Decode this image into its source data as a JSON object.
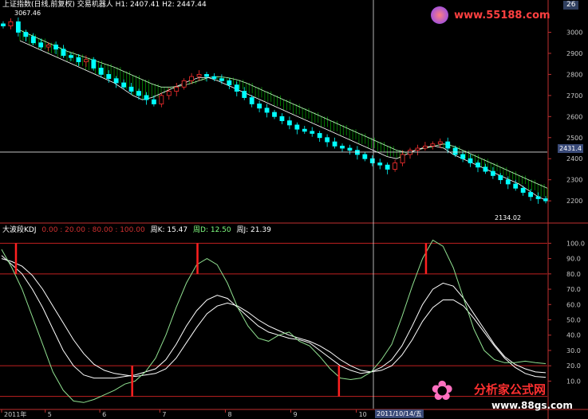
{
  "header": {
    "index_label": "上证指数(日线,前复权)",
    "indicator_name": "交易机器人",
    "h1": "H1: 2407.41",
    "h2": "H2: 2447.44",
    "high_marker": "3067.46",
    "corner_value": "26"
  },
  "kdj_header": {
    "name": "大波段KDJ",
    "levels": "0.00 : 20.00 : 80.00 : 100.00",
    "k": "周K: 15.47",
    "d": "周D: 12.50",
    "j": "周J: 21.39"
  },
  "crosshair": {
    "price": "2431.4",
    "date": "2011/10/14/五"
  },
  "low_marker": "2134.02",
  "watermarks": {
    "top_url": "www.55188.com",
    "bottom_title": "分析家公式网",
    "bottom_url": "www.88gs.com"
  },
  "colors": {
    "background": "#000000",
    "up_candle": "#ff3030",
    "down_candle": "#00ffff",
    "band_fill": "#00c800",
    "k_line": "#ffffff",
    "d_line": "#ffffff",
    "j_line": "#90e090",
    "level_line": "#c02020",
    "signal_bar": "#ff2020"
  },
  "chart_data": [
    {
      "type": "candlestick",
      "title": "上证指数(日线,前复权)",
      "y_ticks": [
        3000,
        2900,
        2800,
        2700,
        2600,
        2500,
        2400,
        2300,
        2200
      ],
      "ylim": [
        2140,
        3070
      ],
      "x_ticks": [
        "2011年",
        "5",
        "6",
        "7",
        "8",
        "9",
        "10"
      ],
      "close_series": [
        3030,
        3050,
        3000,
        2980,
        2950,
        2930,
        2940,
        2920,
        2890,
        2880,
        2860,
        2870,
        2830,
        2800,
        2780,
        2760,
        2740,
        2720,
        2700,
        2680,
        2660,
        2700,
        2720,
        2740,
        2770,
        2790,
        2800,
        2790,
        2780,
        2770,
        2750,
        2720,
        2690,
        2660,
        2640,
        2620,
        2600,
        2580,
        2560,
        2540,
        2530,
        2520,
        2500,
        2480,
        2460,
        2450,
        2440,
        2420,
        2400,
        2380,
        2370,
        2350,
        2380,
        2420,
        2440,
        2450,
        2460,
        2470,
        2480,
        2450,
        2420,
        2400,
        2380,
        2360,
        2340,
        2320,
        2300,
        2280,
        2260,
        2240,
        2220,
        2210,
        2200
      ],
      "band_top": [
        3010,
        2990,
        2970,
        2950,
        2930,
        2910,
        2895,
        2880,
        2865,
        2850,
        2835,
        2815,
        2795,
        2775,
        2755,
        2740,
        2740,
        2745,
        2755,
        2770,
        2785,
        2790,
        2785,
        2775,
        2760,
        2740,
        2720,
        2700,
        2680,
        2660,
        2640,
        2620,
        2600,
        2580,
        2560,
        2540,
        2520,
        2500,
        2480,
        2460,
        2440,
        2430,
        2440,
        2450,
        2460,
        2470,
        2460,
        2440,
        2420,
        2400,
        2380,
        2360,
        2340,
        2320,
        2300,
        2280,
        2260
      ],
      "band_bottom": [
        2960,
        2940,
        2920,
        2900,
        2880,
        2860,
        2840,
        2820,
        2800,
        2780,
        2760,
        2730,
        2700,
        2680,
        2690,
        2710,
        2730,
        2750,
        2770,
        2785,
        2785,
        2770,
        2750,
        2730,
        2710,
        2690,
        2670,
        2650,
        2630,
        2610,
        2590,
        2570,
        2550,
        2530,
        2510,
        2490,
        2470,
        2450,
        2430,
        2410,
        2400,
        2420,
        2440,
        2455,
        2460,
        2450,
        2420,
        2400,
        2380,
        2360,
        2340,
        2320,
        2300,
        2280,
        2250,
        2220,
        2200
      ]
    },
    {
      "type": "line",
      "title": "大波段KDJ",
      "y_ticks": [
        100.0,
        90.0,
        80.0,
        70.0,
        60.0,
        50.0,
        40.0,
        30.0,
        20.0,
        10.0
      ],
      "ylim": [
        -8,
        108
      ],
      "levels": [
        0,
        20,
        80,
        100
      ],
      "series": [
        {
          "name": "周K",
          "values": [
            92,
            86,
            80,
            70,
            58,
            44,
            30,
            20,
            14,
            12,
            12,
            12,
            13,
            14,
            16,
            18,
            24,
            34,
            46,
            56,
            63,
            66,
            64,
            58,
            52,
            46,
            42,
            40,
            38,
            37,
            35,
            30,
            25,
            20,
            17,
            15,
            16,
            19,
            24,
            33,
            46,
            60,
            70,
            74,
            72,
            64,
            54,
            44,
            34,
            26,
            21,
            18,
            16,
            15.47
          ]
        },
        {
          "name": "周D",
          "values": [
            90,
            88,
            85,
            79,
            70,
            59,
            48,
            37,
            28,
            21,
            17,
            15,
            14,
            13,
            14,
            15,
            18,
            25,
            35,
            45,
            54,
            59,
            61,
            59,
            55,
            50,
            46,
            43,
            40,
            38,
            36,
            33,
            29,
            24,
            20,
            17,
            16,
            17,
            20,
            27,
            37,
            49,
            58,
            63,
            63,
            59,
            51,
            42,
            33,
            25,
            19,
            15,
            13,
            12.5
          ]
        },
        {
          "name": "周J",
          "values": [
            96,
            84,
            70,
            52,
            34,
            16,
            4,
            -3,
            -4,
            -2,
            1,
            4,
            8,
            10,
            16,
            25,
            40,
            58,
            74,
            86,
            90,
            86,
            74,
            58,
            46,
            38,
            36,
            40,
            42,
            36,
            33,
            26,
            18,
            12,
            11,
            12,
            16,
            24,
            34,
            52,
            72,
            90,
            102,
            98,
            84,
            64,
            44,
            30,
            24,
            22,
            22,
            23,
            22,
            21.39
          ]
        }
      ],
      "signal_bars": [
        {
          "at": 0.0,
          "from": 100,
          "to": 80
        },
        {
          "at": 0.36,
          "from": 100,
          "to": 80
        },
        {
          "at": 0.24,
          "from": 20,
          "to": 0
        },
        {
          "at": 0.62,
          "from": 20,
          "to": 0
        },
        {
          "at": 0.78,
          "from": 100,
          "to": 80
        }
      ]
    }
  ]
}
